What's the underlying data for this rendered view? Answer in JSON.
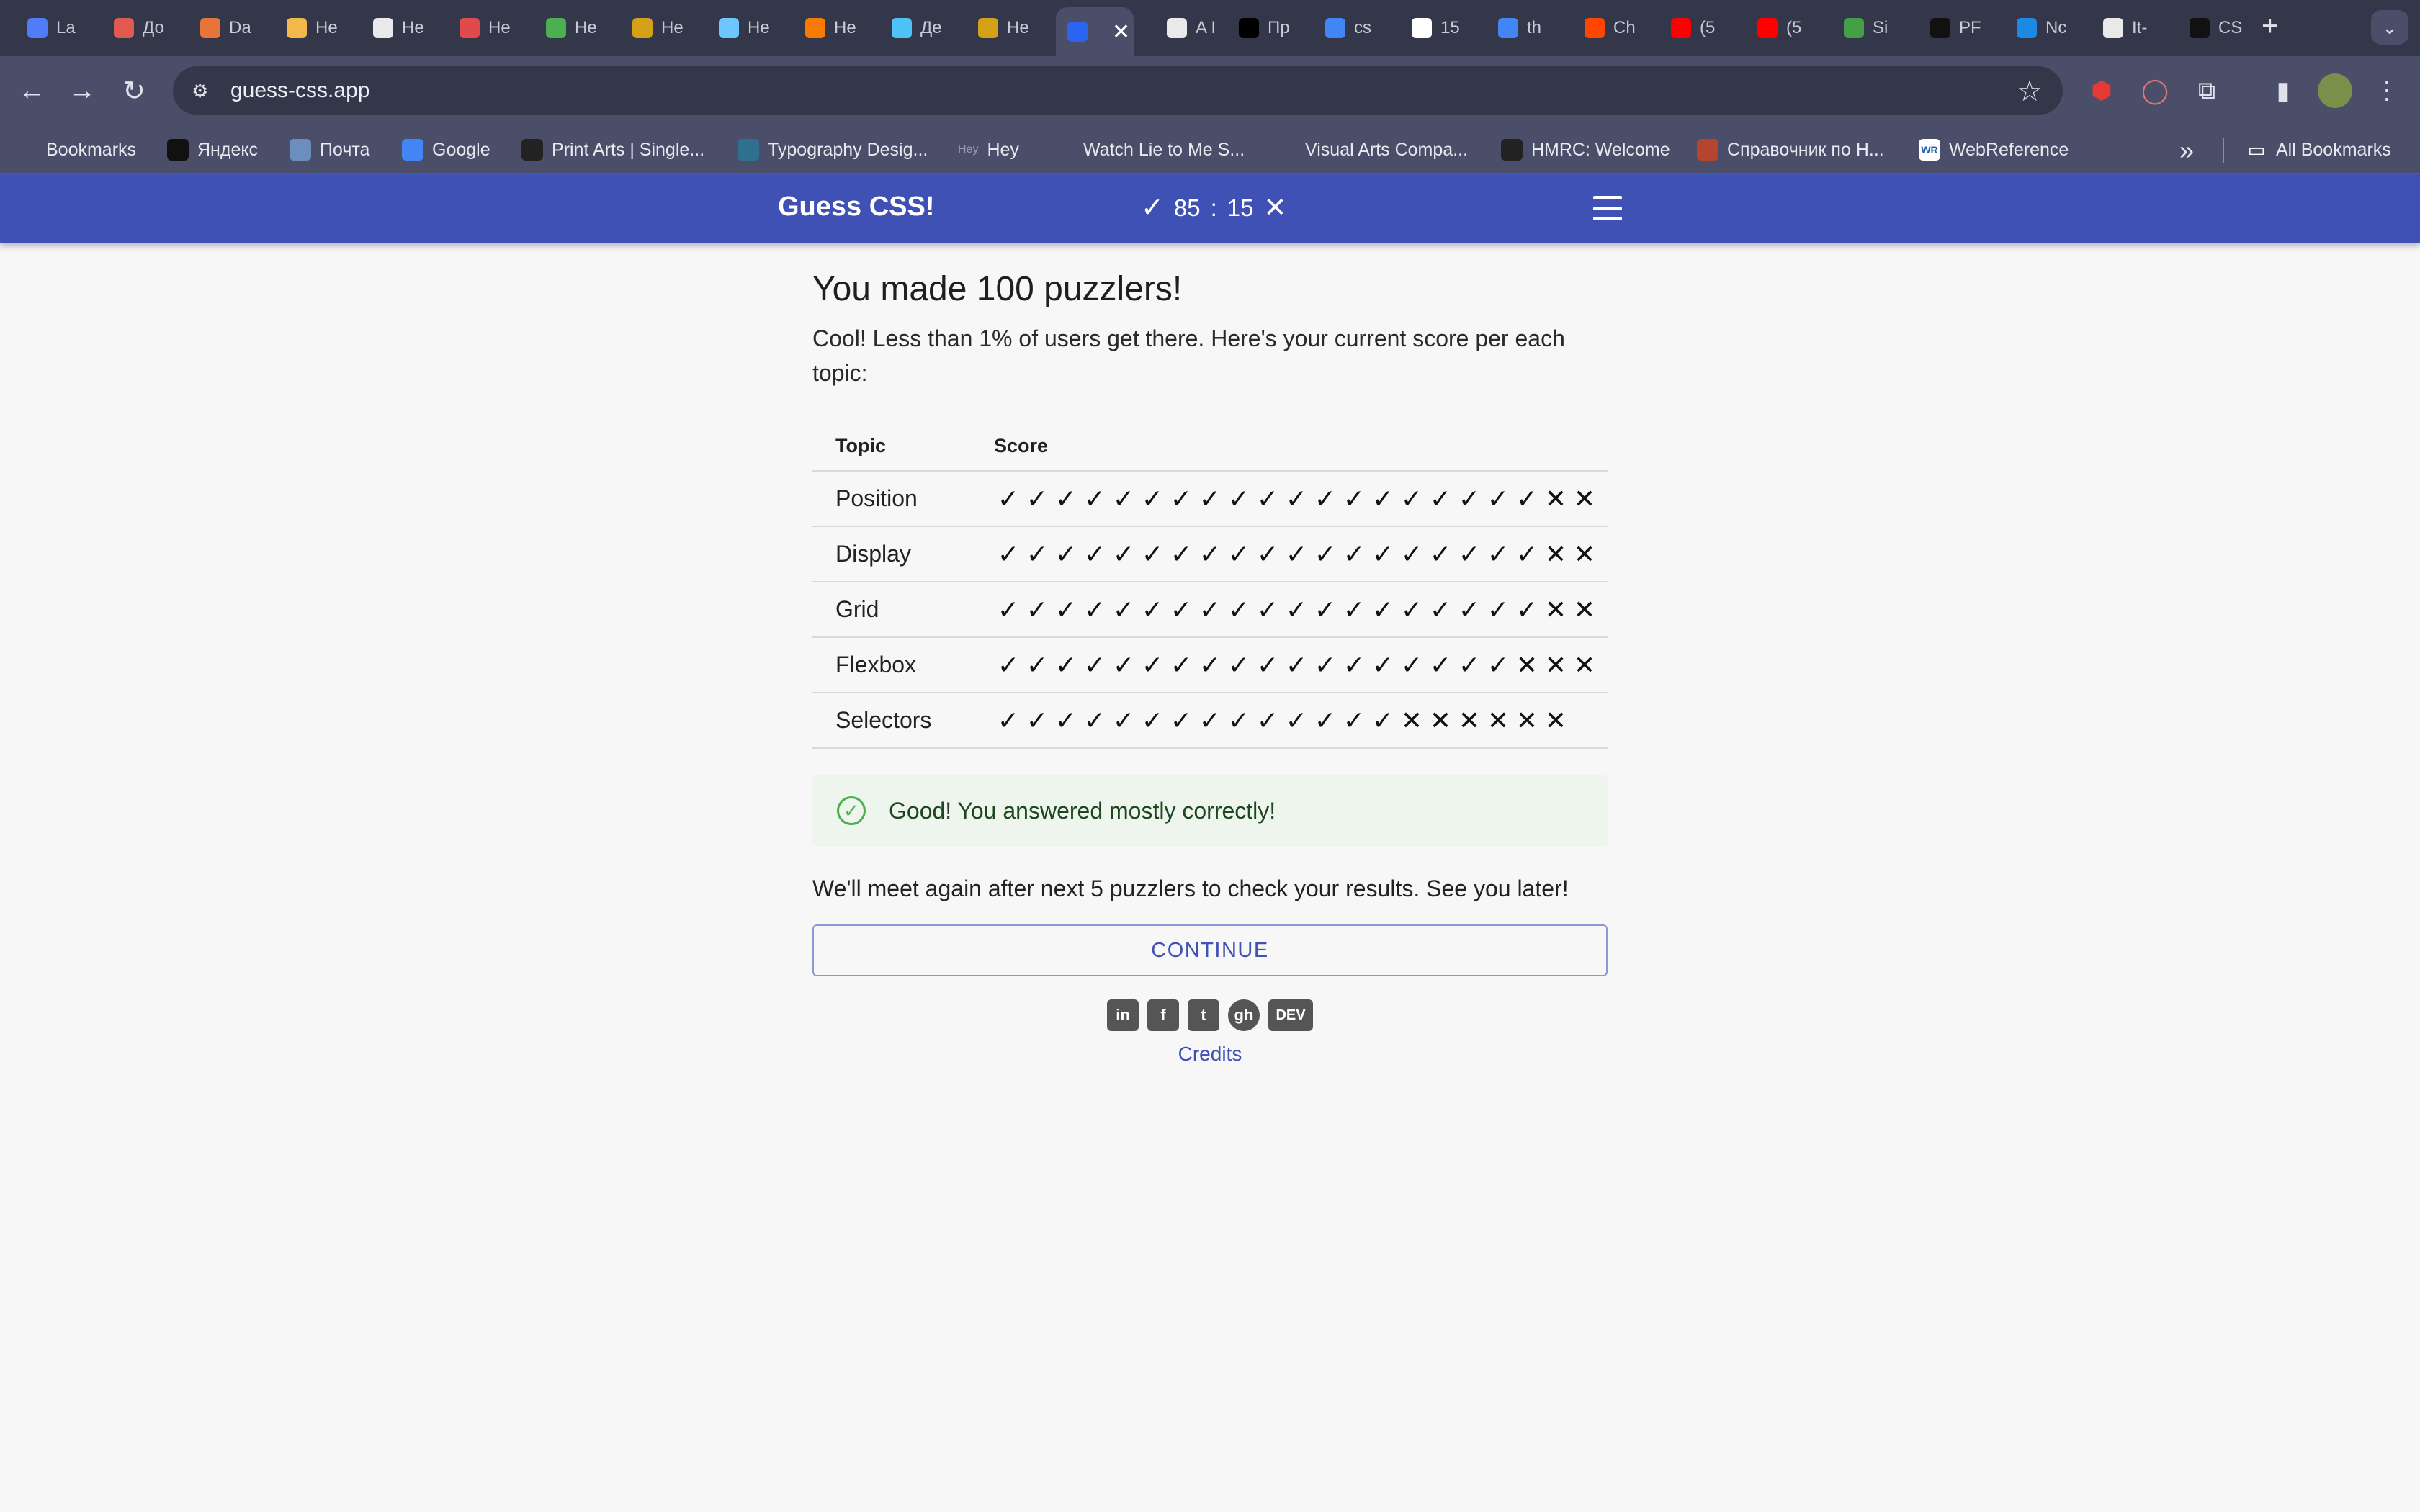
{
  "browser": {
    "tabs": [
      {
        "label": "La",
        "color": "#4f7cf7"
      },
      {
        "label": "До",
        "color": "#e05a4f"
      },
      {
        "label": "Da",
        "color": "#e8743b"
      },
      {
        "label": "He",
        "color": "#f2b84b"
      },
      {
        "label": "He",
        "color": "#e9e9e9"
      },
      {
        "label": "He",
        "color": "#e04a4a"
      },
      {
        "label": "He",
        "color": "#4caf50"
      },
      {
        "label": "He",
        "color": "#d4a017"
      },
      {
        "label": "He",
        "color": "#6ec6ff"
      },
      {
        "label": "He",
        "color": "#f57c00"
      },
      {
        "label": "Де",
        "color": "#4fc3f7"
      },
      {
        "label": "He",
        "color": "#d4a017"
      },
      {
        "label": "A I",
        "color": "#e9e9e9"
      },
      {
        "label": "Пр",
        "color": "#000000"
      },
      {
        "label": "cs",
        "color": "#4285f4"
      },
      {
        "label": "15",
        "color": "#ffffff"
      },
      {
        "label": "th",
        "color": "#4285f4"
      },
      {
        "label": "Ch",
        "color": "#ff4500"
      },
      {
        "label": "(5",
        "color": "#ff0000"
      },
      {
        "label": "(5",
        "color": "#ff0000"
      },
      {
        "label": "Si",
        "color": "#43a047"
      },
      {
        "label": "PF",
        "color": "#111111"
      },
      {
        "label": "Nc",
        "color": "#1e88e5"
      },
      {
        "label": "It-",
        "color": "#e9e9e9"
      },
      {
        "label": "CS",
        "color": "#111111"
      }
    ],
    "active_tab_color": "#2965f1",
    "url": "guess-css.app",
    "bookmarks": [
      {
        "label": "Bookmarks",
        "color": "#4a4e68"
      },
      {
        "label": "Яндекс",
        "color": "#111111"
      },
      {
        "label": "Почта",
        "color": "#6c8ebf"
      },
      {
        "label": "Google",
        "color": "#4285f4"
      },
      {
        "label": "Print Arts | Single...",
        "color": "#222222"
      },
      {
        "label": "Typography Desig...",
        "color": "#2f6f8f"
      },
      {
        "label": "Hey",
        "color": "#4a4e68",
        "prefix": "Hey"
      },
      {
        "label": "Watch Lie to Me S...",
        "color": "#4a4e68"
      },
      {
        "label": "Visual Arts Compa...",
        "color": "#4a4e68"
      },
      {
        "label": "HMRC: Welcome",
        "color": "#222222"
      },
      {
        "label": "Справочник по Н...",
        "color": "#b5452f"
      },
      {
        "label": "WebReference",
        "color": "#ffffff",
        "prefix": "WR"
      }
    ],
    "all_bookmarks": "All Bookmarks"
  },
  "app": {
    "title": "Guess CSS!",
    "correct": "85",
    "sep": ":",
    "wrong": "15",
    "accent": "#3f51b5"
  },
  "main": {
    "heading": "You made 100 puzzlers!",
    "intro": "Cool! Less than 1% of users get there. Here's your current score per each topic:",
    "table": {
      "headers": [
        "Topic",
        "Score"
      ],
      "rows": [
        {
          "topic": "Position",
          "correct": 19,
          "wrong": 2
        },
        {
          "topic": "Display",
          "correct": 19,
          "wrong": 2
        },
        {
          "topic": "Grid",
          "correct": 19,
          "wrong": 2
        },
        {
          "topic": "Flexbox",
          "correct": 18,
          "wrong": 3
        },
        {
          "topic": "Selectors",
          "correct": 14,
          "wrong": 6
        }
      ]
    },
    "alert": "Good! You answered mostly correctly!",
    "followup": "We'll meet again after next 5 puzzlers to check your results. See you later!",
    "continue_label": "CONTINUE",
    "social": [
      {
        "name": "linkedin",
        "glyph": "in"
      },
      {
        "name": "facebook",
        "glyph": "f"
      },
      {
        "name": "twitter",
        "glyph": "t"
      },
      {
        "name": "github",
        "glyph": "gh"
      },
      {
        "name": "dev",
        "glyph": "DEV"
      }
    ],
    "credits": "Credits"
  }
}
